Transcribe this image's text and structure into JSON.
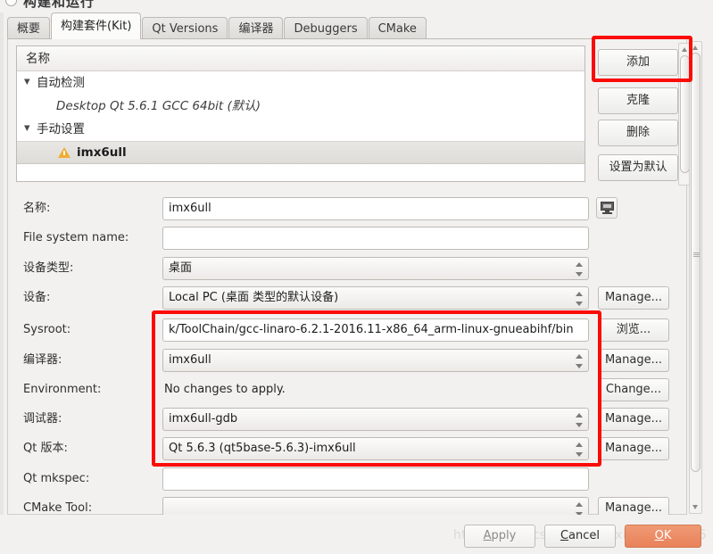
{
  "dialog": {
    "title": "构建和运行"
  },
  "tabs": [
    {
      "label": "概要",
      "active": false
    },
    {
      "label": "构建套件(Kit)",
      "active": true
    },
    {
      "label": "Qt Versions",
      "active": false
    },
    {
      "label": "编译器",
      "active": false
    },
    {
      "label": "Debuggers",
      "active": false
    },
    {
      "label": "CMake",
      "active": false
    }
  ],
  "kit_list": {
    "column_header": "名称",
    "rows": [
      {
        "type": "group",
        "twisty": "▼",
        "label": "自动检测"
      },
      {
        "type": "child",
        "label": "Desktop Qt 5.6.1 GCC 64bit (默认)"
      },
      {
        "type": "group",
        "twisty": "▼",
        "label": "手动设置"
      },
      {
        "type": "leaf",
        "label": "imx6ull",
        "warning": true,
        "selected": true
      }
    ]
  },
  "side_buttons": [
    {
      "id": "add",
      "label": "添加",
      "highlighted": true
    },
    {
      "id": "clone",
      "label": "克隆",
      "highlighted": false
    },
    {
      "id": "delete",
      "label": "删除",
      "highlighted": false
    },
    {
      "id": "set_default",
      "label": "设置为默认",
      "highlighted": false
    }
  ],
  "form": {
    "fields": [
      {
        "id": "name",
        "label": "名称:",
        "kind": "input",
        "value": "imx6ull"
      },
      {
        "id": "file_system",
        "label": "File system name:",
        "kind": "input",
        "value": ""
      },
      {
        "id": "device_type",
        "label": "设备类型:",
        "kind": "combo",
        "value": "桌面"
      },
      {
        "id": "device",
        "label": "设备:",
        "kind": "combo",
        "value": "Local PC (桌面 类型的默认设备)",
        "action": "Manage..."
      },
      {
        "id": "sysroot",
        "label": "Sysroot:",
        "kind": "input",
        "value": "k/ToolChain/gcc-linaro-6.2.1-2016.11-x86_64_arm-linux-gnueabihf/bin",
        "action": "浏览..."
      },
      {
        "id": "compiler",
        "label": "编译器:",
        "kind": "combo",
        "value": "imx6ull",
        "action": "Manage..."
      },
      {
        "id": "environment",
        "label": "Environment:",
        "kind": "static",
        "value": "No changes to apply.",
        "action": "Change..."
      },
      {
        "id": "debugger",
        "label": "调试器:",
        "kind": "combo",
        "value": "imx6ull-gdb",
        "action": "Manage..."
      },
      {
        "id": "qt_version",
        "label": "Qt 版本:",
        "kind": "combo",
        "value": "Qt 5.6.3 (qt5base-5.6.3)-imx6ull",
        "action": "Manage..."
      },
      {
        "id": "qt_mkspec",
        "label": "Qt mkspec:",
        "kind": "input",
        "value": ""
      },
      {
        "id": "cmake_tool",
        "label": "CMake Tool:",
        "kind": "combo",
        "value": "",
        "action": "Manage..."
      }
    ],
    "name_icon": "monitor-icon"
  },
  "bottom_buttons": [
    {
      "id": "apply",
      "label": "Apply",
      "underline": "A",
      "disabled": true
    },
    {
      "id": "cancel",
      "label": "Cancel",
      "underline": "C",
      "disabled": false
    },
    {
      "id": "ok",
      "label": "OK",
      "underline": "O",
      "primary": true
    }
  ],
  "watermark": {
    "text": "https://blog.csdn.net/weixin_45966765"
  },
  "annotations": {
    "accent_color": "#fb0b05",
    "boxes": [
      {
        "id": "add-button-highlight",
        "target": "添加"
      },
      {
        "id": "toolchain-fields-highlight",
        "target": "Sysroot / 编译器 / Environment / 调试器 / Qt 版本"
      }
    ]
  }
}
